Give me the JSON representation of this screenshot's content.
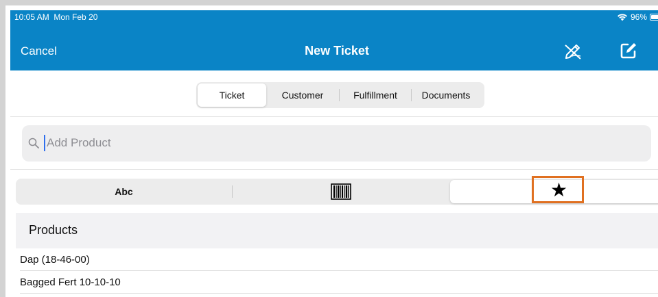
{
  "status": {
    "time": "10:05 AM",
    "date": "Mon Feb 20",
    "battery": "96%"
  },
  "nav": {
    "cancel": "Cancel",
    "title": "New Ticket",
    "sign_icon": "signature-pen-icon",
    "edit_icon": "compose-edit-icon"
  },
  "tabs": [
    {
      "label": "Ticket",
      "active": true
    },
    {
      "label": "Customer",
      "active": false
    },
    {
      "label": "Fulfillment",
      "active": false
    },
    {
      "label": "Documents",
      "active": false
    }
  ],
  "search": {
    "placeholder": "Add Product",
    "value": ""
  },
  "view_modes": {
    "abc": "Abc",
    "barcode_icon": "barcode-icon",
    "favorites_icon": "star-icon",
    "selected": "favorites"
  },
  "products": {
    "header": "Products",
    "items": [
      {
        "name": "Dap (18-46-00)"
      },
      {
        "name": "Bagged Fert 10-10-10"
      }
    ]
  },
  "colors": {
    "nav_background": "#0a84c6",
    "highlight_box": "#e07020",
    "caret": "#2f6fed"
  }
}
